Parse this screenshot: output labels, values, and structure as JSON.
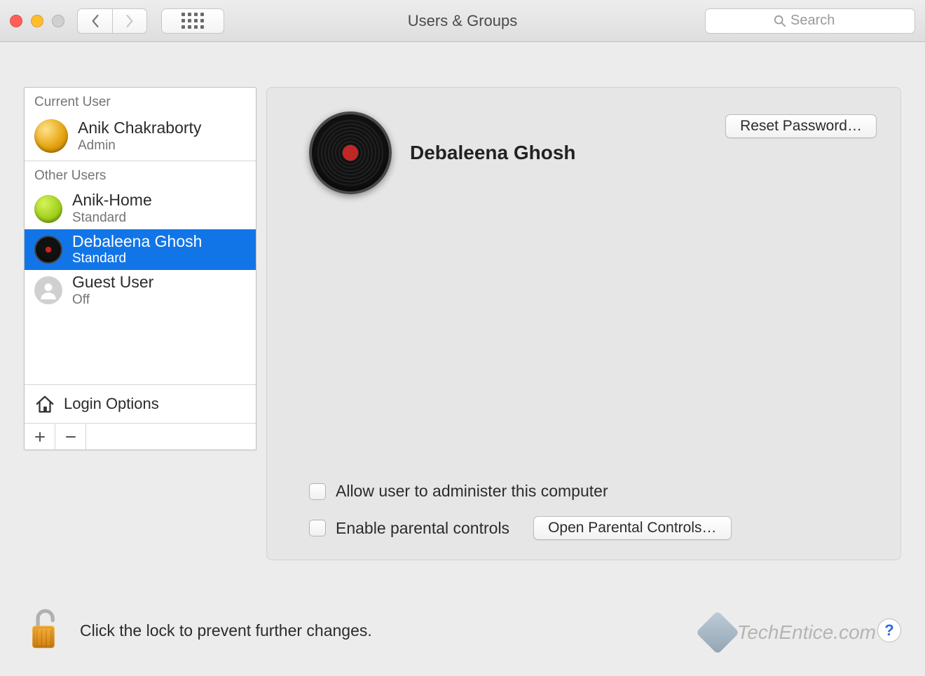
{
  "window": {
    "title": "Users & Groups"
  },
  "search": {
    "placeholder": "Search"
  },
  "sidebar": {
    "current_label": "Current User",
    "other_label": "Other Users",
    "current_user": {
      "name": "Anik Chakraborty",
      "role": "Admin"
    },
    "others": [
      {
        "name": "Anik-Home",
        "role": "Standard"
      },
      {
        "name": "Debaleena Ghosh",
        "role": "Standard"
      },
      {
        "name": "Guest User",
        "role": "Off"
      }
    ],
    "login_options": "Login Options"
  },
  "main": {
    "selected_user": "Debaleena Ghosh",
    "reset_password": "Reset Password…",
    "allow_admin": "Allow user to administer this computer",
    "enable_parental": "Enable parental controls",
    "open_parental": "Open Parental Controls…"
  },
  "footer": {
    "lock_text": "Click the lock to prevent further changes."
  },
  "watermark": {
    "text": "TechEntice.com"
  }
}
